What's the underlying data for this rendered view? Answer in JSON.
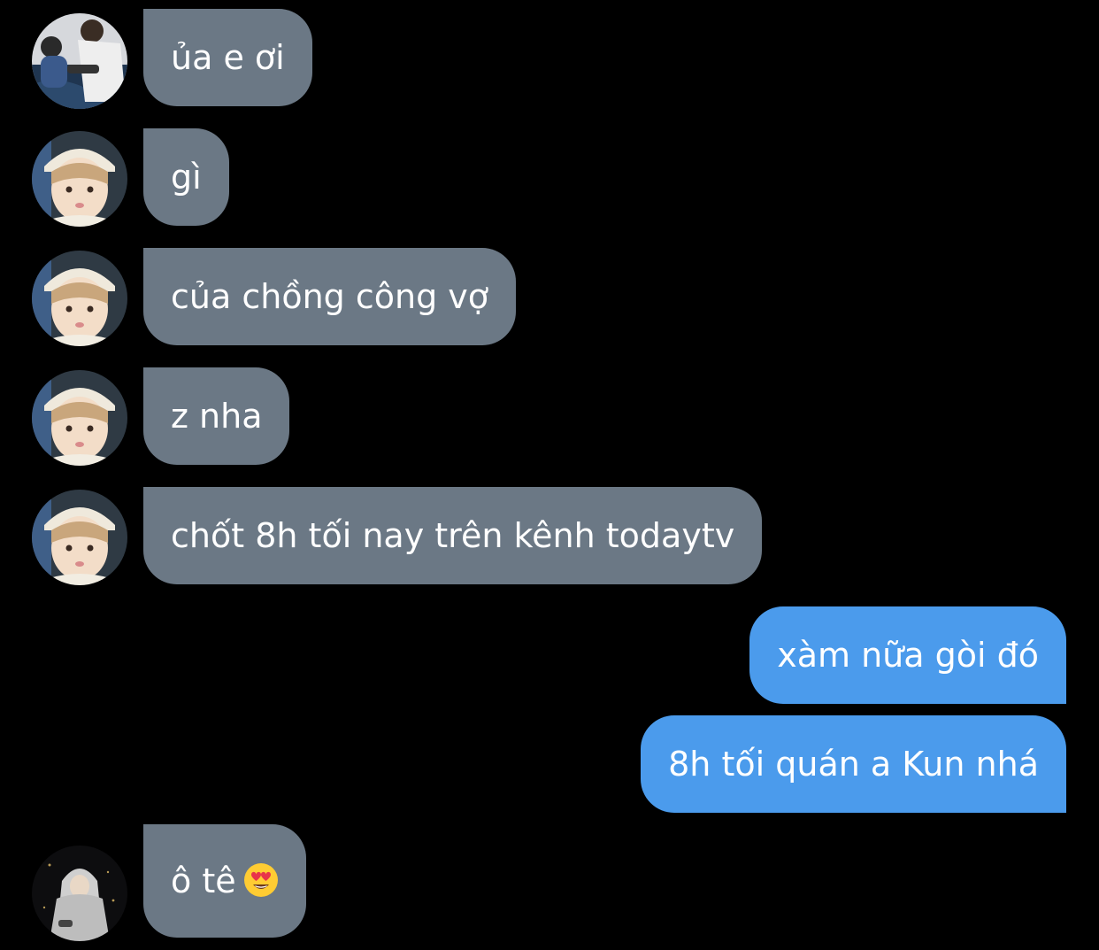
{
  "conversation": {
    "messages": [
      {
        "direction": "in",
        "sender": "friend-a",
        "text": "ủa e ơi"
      },
      {
        "direction": "in",
        "sender": "friend-b",
        "text": "gì"
      },
      {
        "direction": "in",
        "sender": "friend-b",
        "text": "của chồng công vợ"
      },
      {
        "direction": "in",
        "sender": "friend-b",
        "text": "z nha"
      },
      {
        "direction": "in",
        "sender": "friend-b",
        "text": "chốt 8h tối nay trên kênh todaytv"
      },
      {
        "direction": "out",
        "sender": "me",
        "text": "xàm nữa gòi đó"
      },
      {
        "direction": "out",
        "sender": "me",
        "text": "8h tối quán a Kun nhá"
      },
      {
        "direction": "in",
        "sender": "friend-c",
        "text": "ô tê",
        "emoji": "heart-eyes"
      }
    ]
  },
  "colors": {
    "background": "#000000",
    "incoming_bubble": "#6b7885",
    "outgoing_bubble": "#4b9bec",
    "text": "#ffffff"
  }
}
